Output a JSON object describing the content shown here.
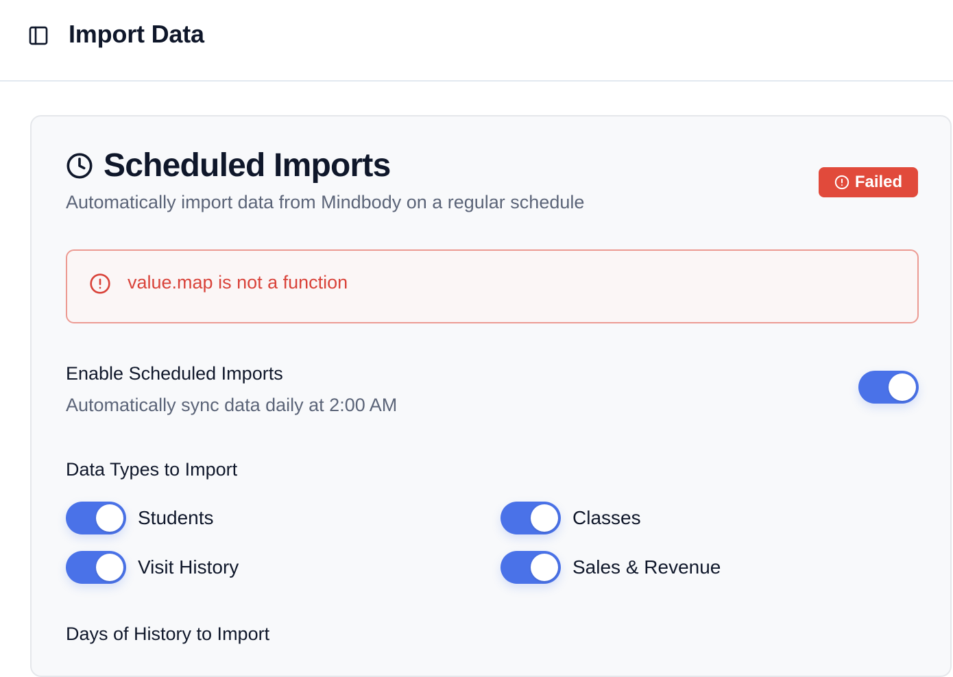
{
  "header": {
    "title": "Import Data",
    "sidebar_toggle_icon": "sidebar-panel-icon"
  },
  "card": {
    "icon": "clock-icon",
    "title": "Scheduled Imports",
    "subtitle": "Automatically import data from Mindbody on a regular schedule",
    "status": {
      "label": "Failed",
      "icon": "alert-circle-icon",
      "color": "#e14a3b"
    },
    "error": {
      "icon": "alert-circle-icon",
      "message": "value.map is not a function",
      "color": "#d9433a"
    },
    "enable_setting": {
      "label": "Enable Scheduled Imports",
      "description": "Automatically sync data daily at 2:00 AM",
      "enabled": true
    },
    "data_types": {
      "heading": "Data Types to Import",
      "items": [
        {
          "label": "Students",
          "enabled": true
        },
        {
          "label": "Classes",
          "enabled": true
        },
        {
          "label": "Visit History",
          "enabled": true
        },
        {
          "label": "Sales & Revenue",
          "enabled": true
        }
      ]
    },
    "history": {
      "heading": "Days of History to Import"
    }
  },
  "colors": {
    "accent": "#4a72e8",
    "danger": "#e14a3b",
    "text_primary": "#0f172a",
    "text_muted": "#5b6478"
  }
}
